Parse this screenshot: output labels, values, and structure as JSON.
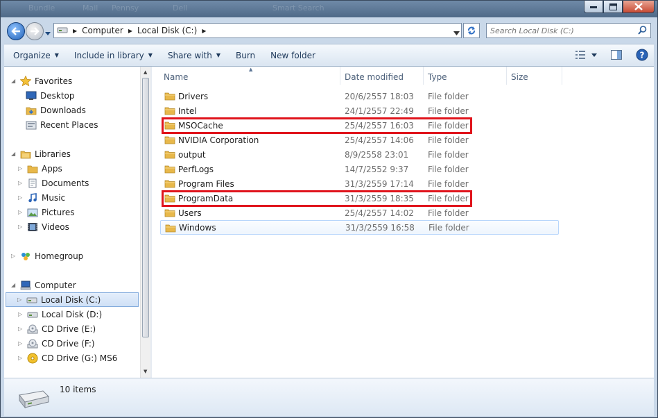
{
  "titlebar": {
    "ghost_items": [
      "Bundle",
      "Mail",
      "Pennsy",
      "Dell",
      "Smart Search"
    ]
  },
  "address": {
    "crumbs": [
      "Computer",
      "Local Disk (C:)"
    ]
  },
  "search": {
    "placeholder": "Search Local Disk (C:)"
  },
  "toolbar": {
    "organize": "Organize",
    "include_in_library": "Include in library",
    "share_with": "Share with",
    "burn": "Burn",
    "new_folder": "New folder"
  },
  "nav": {
    "favorites": {
      "label": "Favorites",
      "items": [
        "Desktop",
        "Downloads",
        "Recent Places"
      ]
    },
    "libraries": {
      "label": "Libraries",
      "items": [
        "Apps",
        "Documents",
        "Music",
        "Pictures",
        "Videos"
      ]
    },
    "homegroup": "Homegroup",
    "computer": {
      "label": "Computer",
      "items": [
        "Local Disk (C:)",
        "Local Disk (D:)",
        "CD Drive (E:)",
        "CD Drive (F:)",
        "CD Drive (G:) MS6"
      ]
    }
  },
  "columns": {
    "name": "Name",
    "date": "Date modified",
    "type": "Type",
    "size": "Size"
  },
  "files": [
    {
      "name": "Drivers",
      "date": "20/6/2557 18:03",
      "type": "File folder"
    },
    {
      "name": "Intel",
      "date": "24/1/2557 22:49",
      "type": "File folder"
    },
    {
      "name": "MSOCache",
      "date": "25/4/2557 16:03",
      "type": "File folder",
      "highlighted": true
    },
    {
      "name": "NVIDIA Corporation",
      "date": "25/4/2557 14:06",
      "type": "File folder"
    },
    {
      "name": "output",
      "date": "8/9/2558 23:01",
      "type": "File folder"
    },
    {
      "name": "PerfLogs",
      "date": "14/7/2552 9:37",
      "type": "File folder"
    },
    {
      "name": "Program Files",
      "date": "31/3/2559 17:14",
      "type": "File folder"
    },
    {
      "name": "ProgramData",
      "date": "31/3/2559 18:35",
      "type": "File folder",
      "highlighted": true
    },
    {
      "name": "Users",
      "date": "25/4/2557 14:02",
      "type": "File folder"
    },
    {
      "name": "Windows",
      "date": "31/3/2559 16:58",
      "type": "File folder",
      "hovered": true
    }
  ],
  "status": {
    "item_count": "10 items"
  },
  "colors": {
    "highlight": "#e0141c",
    "folder": "#e8b84a",
    "link": "#1e395b"
  }
}
